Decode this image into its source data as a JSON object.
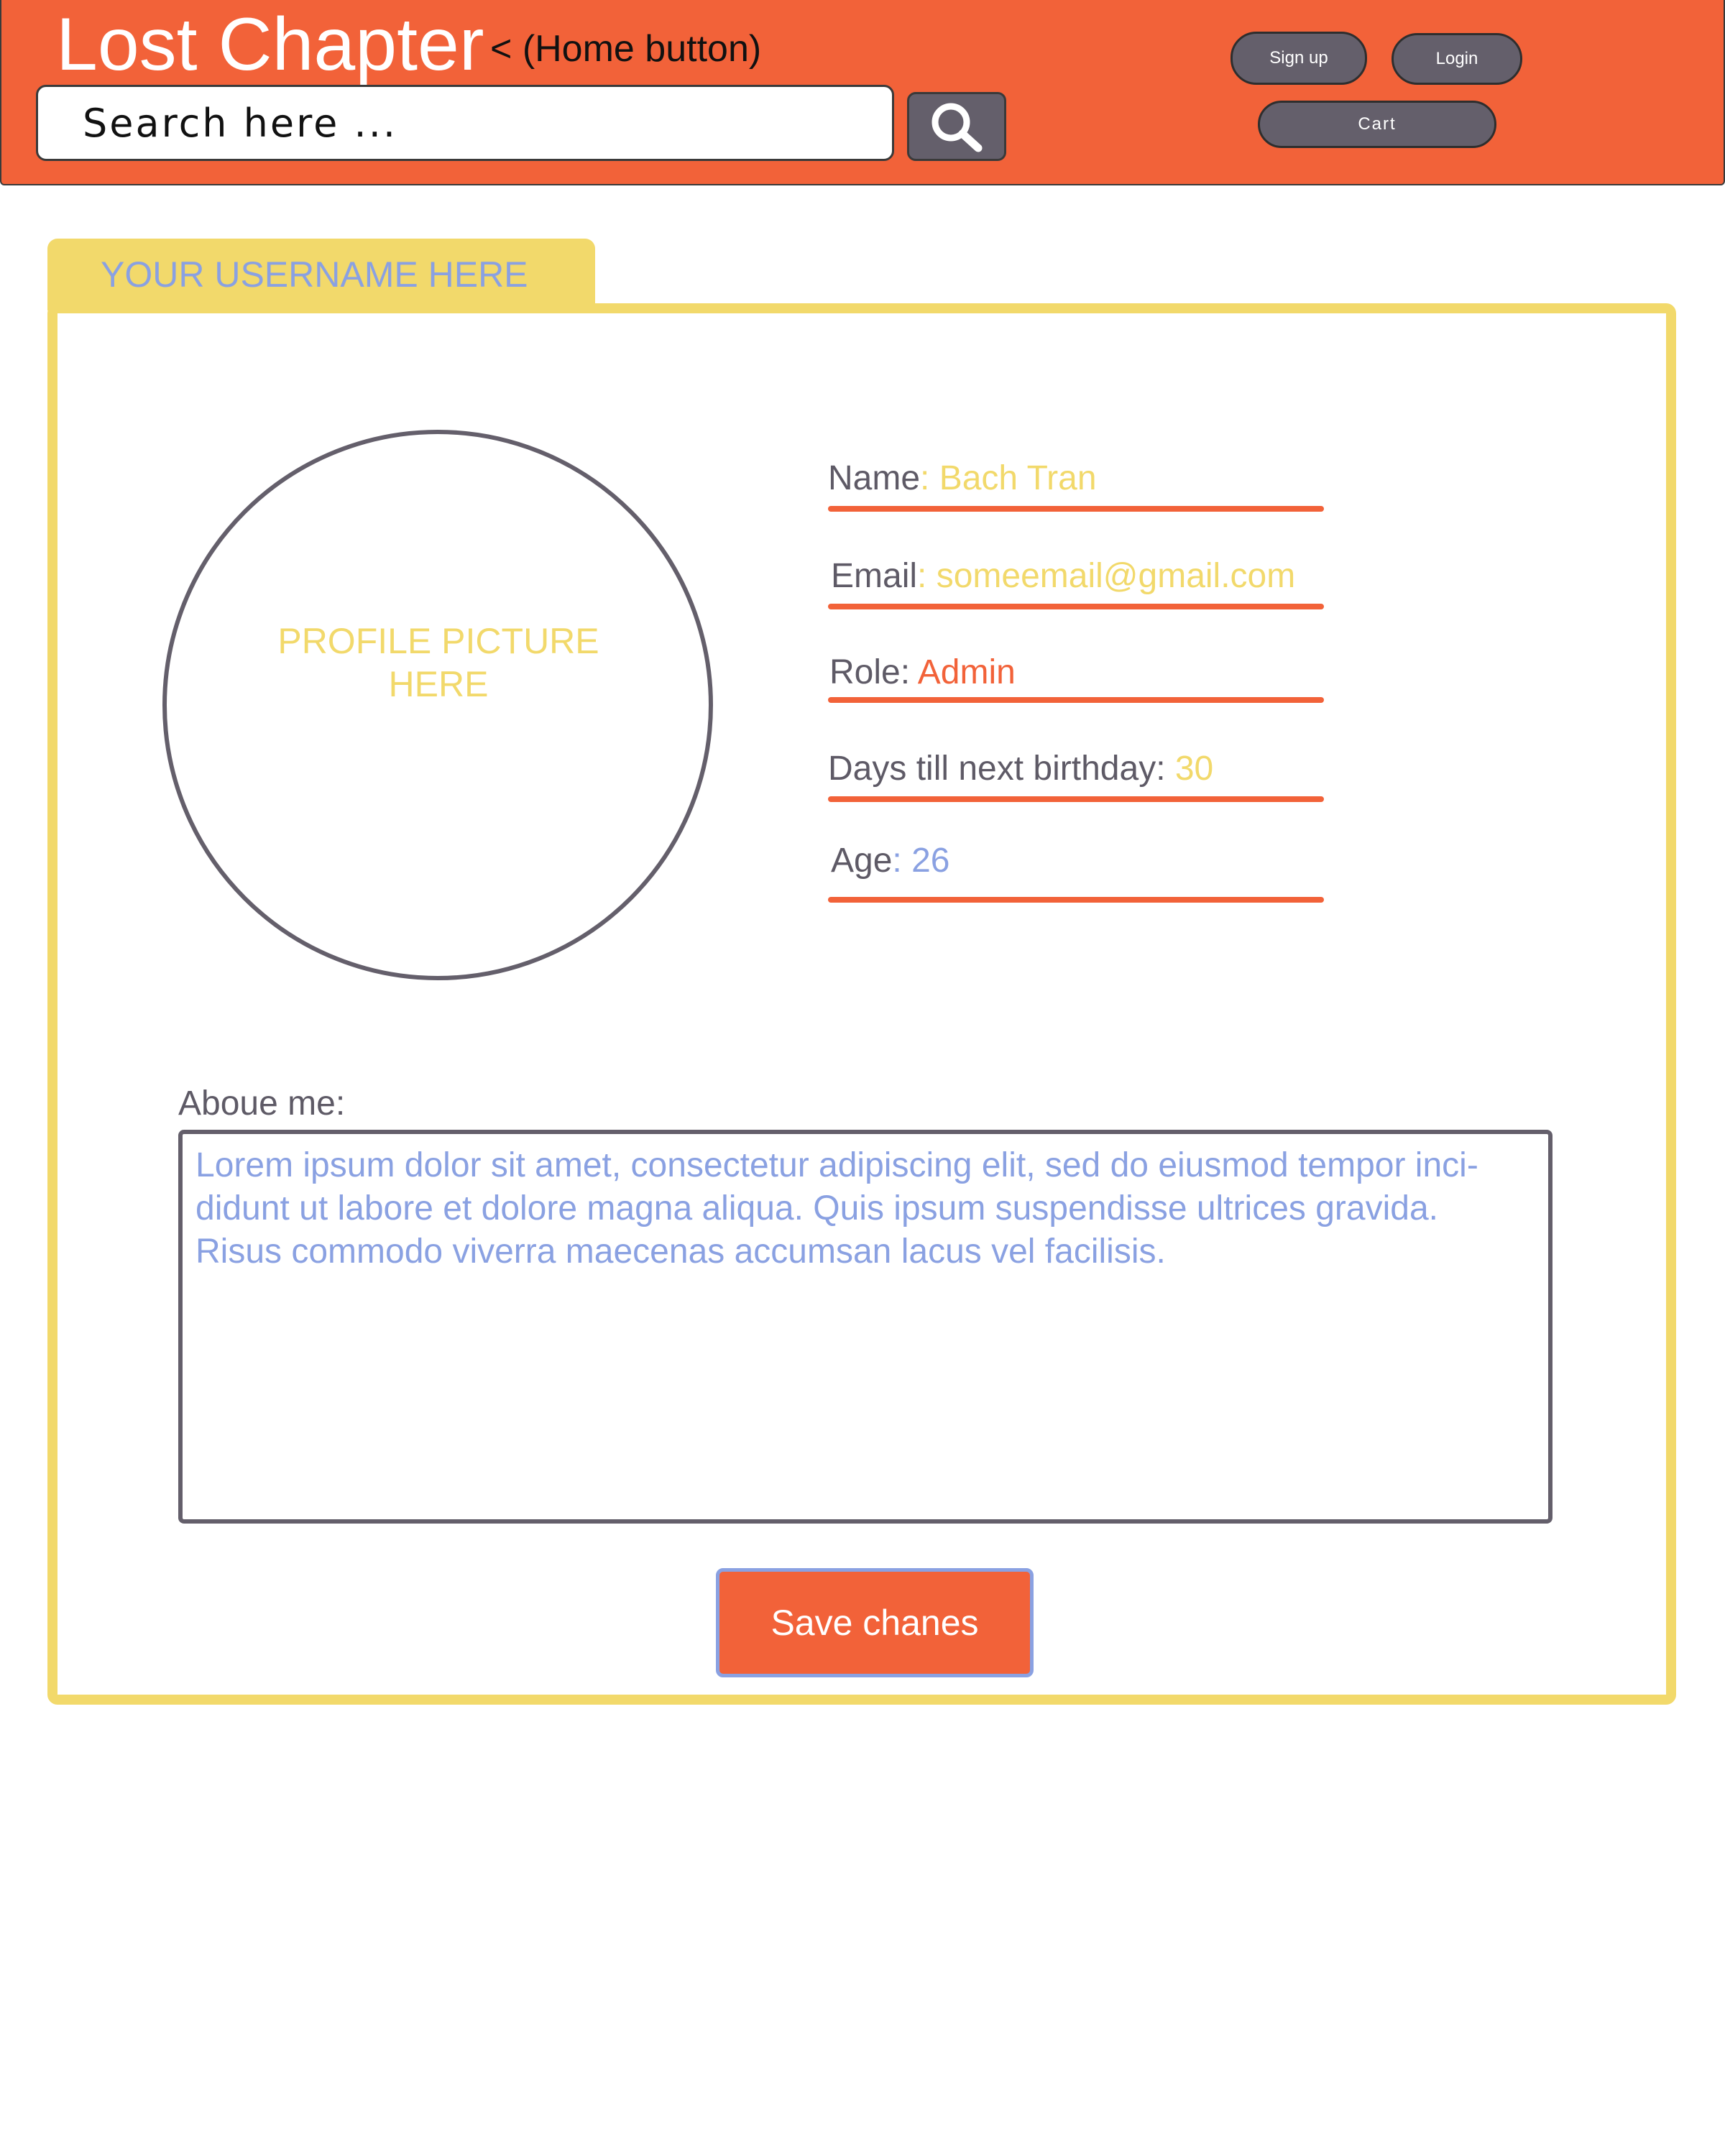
{
  "header": {
    "logo": "Lost Chapter",
    "home_note": "< (Home button)",
    "search": {
      "placeholder": "Search here ..."
    },
    "buttons": {
      "signup": "Sign up",
      "login": "Login",
      "cart": "Cart"
    }
  },
  "profile": {
    "username_tab": "YOUR USERNAME HERE",
    "picture_placeholder_line1": "PROFILE PICTURE",
    "picture_placeholder_line2": "HERE",
    "fields": {
      "name": {
        "label": "Name",
        "value": "Bach Tran"
      },
      "email": {
        "label": "Email",
        "value": "someemail@gmail.com"
      },
      "role": {
        "label": "Role",
        "value": "Admin"
      },
      "birthday": {
        "label": "Days till next birthday",
        "value": "30"
      },
      "age": {
        "label": "Age",
        "value": "26"
      }
    },
    "about": {
      "label": "Aboue me:",
      "lines": [
        "Lorem ipsum dolor sit amet, consectetur adipiscing elit, sed do eiusmod tempor inci-",
        "didunt ut labore et dolore magna aliqua. Quis ipsum suspendisse ultrices gravida.",
        "Risus commodo viverra maecenas accumsan lacus vel facilisis."
      ]
    },
    "save_label": "Save chanes"
  },
  "colors": {
    "header_orange": "#f26239",
    "accent_yellow": "#f2d96b",
    "accent_blue": "#8aa1e2",
    "button_gray": "#645f6b"
  }
}
